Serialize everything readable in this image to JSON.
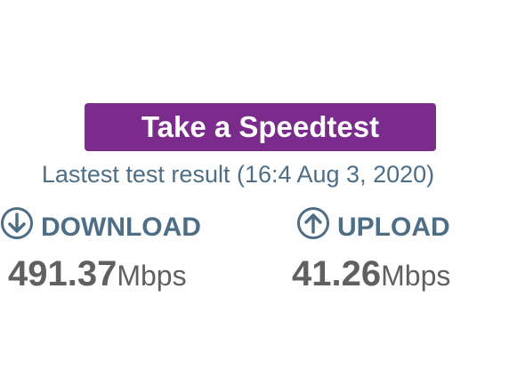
{
  "button": {
    "label": "Take a Speedtest"
  },
  "result": {
    "text": "Lastest test result (16:4 Aug 3, 2020)"
  },
  "download": {
    "label": "DOWNLOAD",
    "value": "491.37",
    "unit": "Mbps",
    "icon": "arrow-down-circle-icon"
  },
  "upload": {
    "label": "UPLOAD",
    "value": "41.26",
    "unit": "Mbps",
    "icon": "arrow-up-circle-icon"
  },
  "colors": {
    "button_bg": "#7b2b8b",
    "label_text": "#4e6e86",
    "value_text": "#606060"
  }
}
